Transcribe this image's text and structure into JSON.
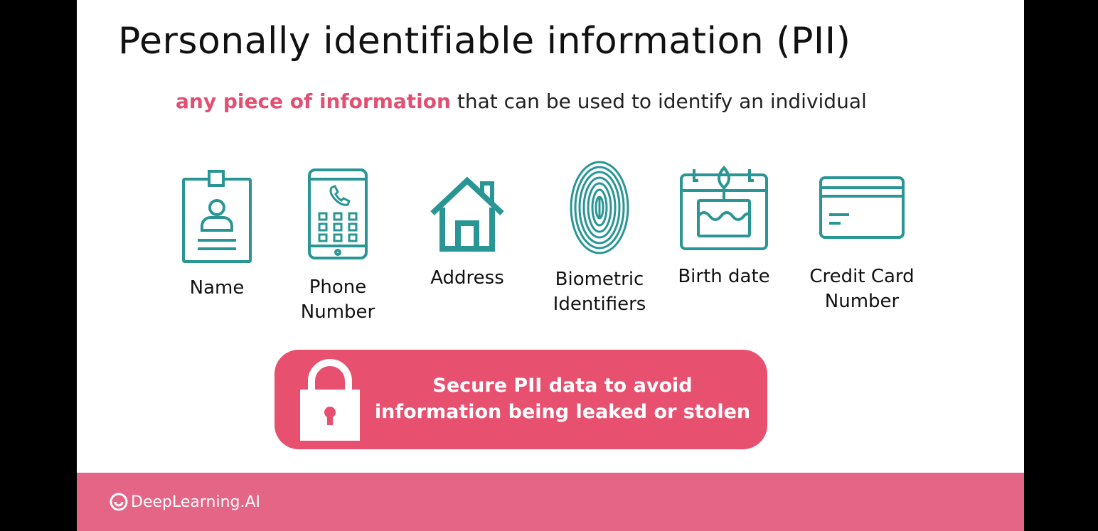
{
  "slide": {
    "title": "Personally identifiable information (PII)",
    "subtitle_highlight": "any piece of information",
    "subtitle_rest": " that can be used to identify an individual",
    "accent_color": "#e8506f",
    "icon_color": "#2a9595"
  },
  "icons": [
    {
      "name": "id-badge-icon",
      "label": "Name"
    },
    {
      "name": "phone-icon",
      "label": "Phone\nNumber"
    },
    {
      "name": "house-icon",
      "label": "Address"
    },
    {
      "name": "fingerprint-icon",
      "label": "Biometric\nIdentifiers"
    },
    {
      "name": "birthday-calendar-icon",
      "label": "Birth date"
    },
    {
      "name": "credit-card-icon",
      "label": "Credit Card\nNumber"
    }
  ],
  "banner": {
    "text": "Secure PII data to avoid\ninformation being leaked or stolen",
    "icon": "lock-icon"
  },
  "footer": {
    "logo_text": "DeepLearning.AI",
    "color": "#e46586"
  }
}
